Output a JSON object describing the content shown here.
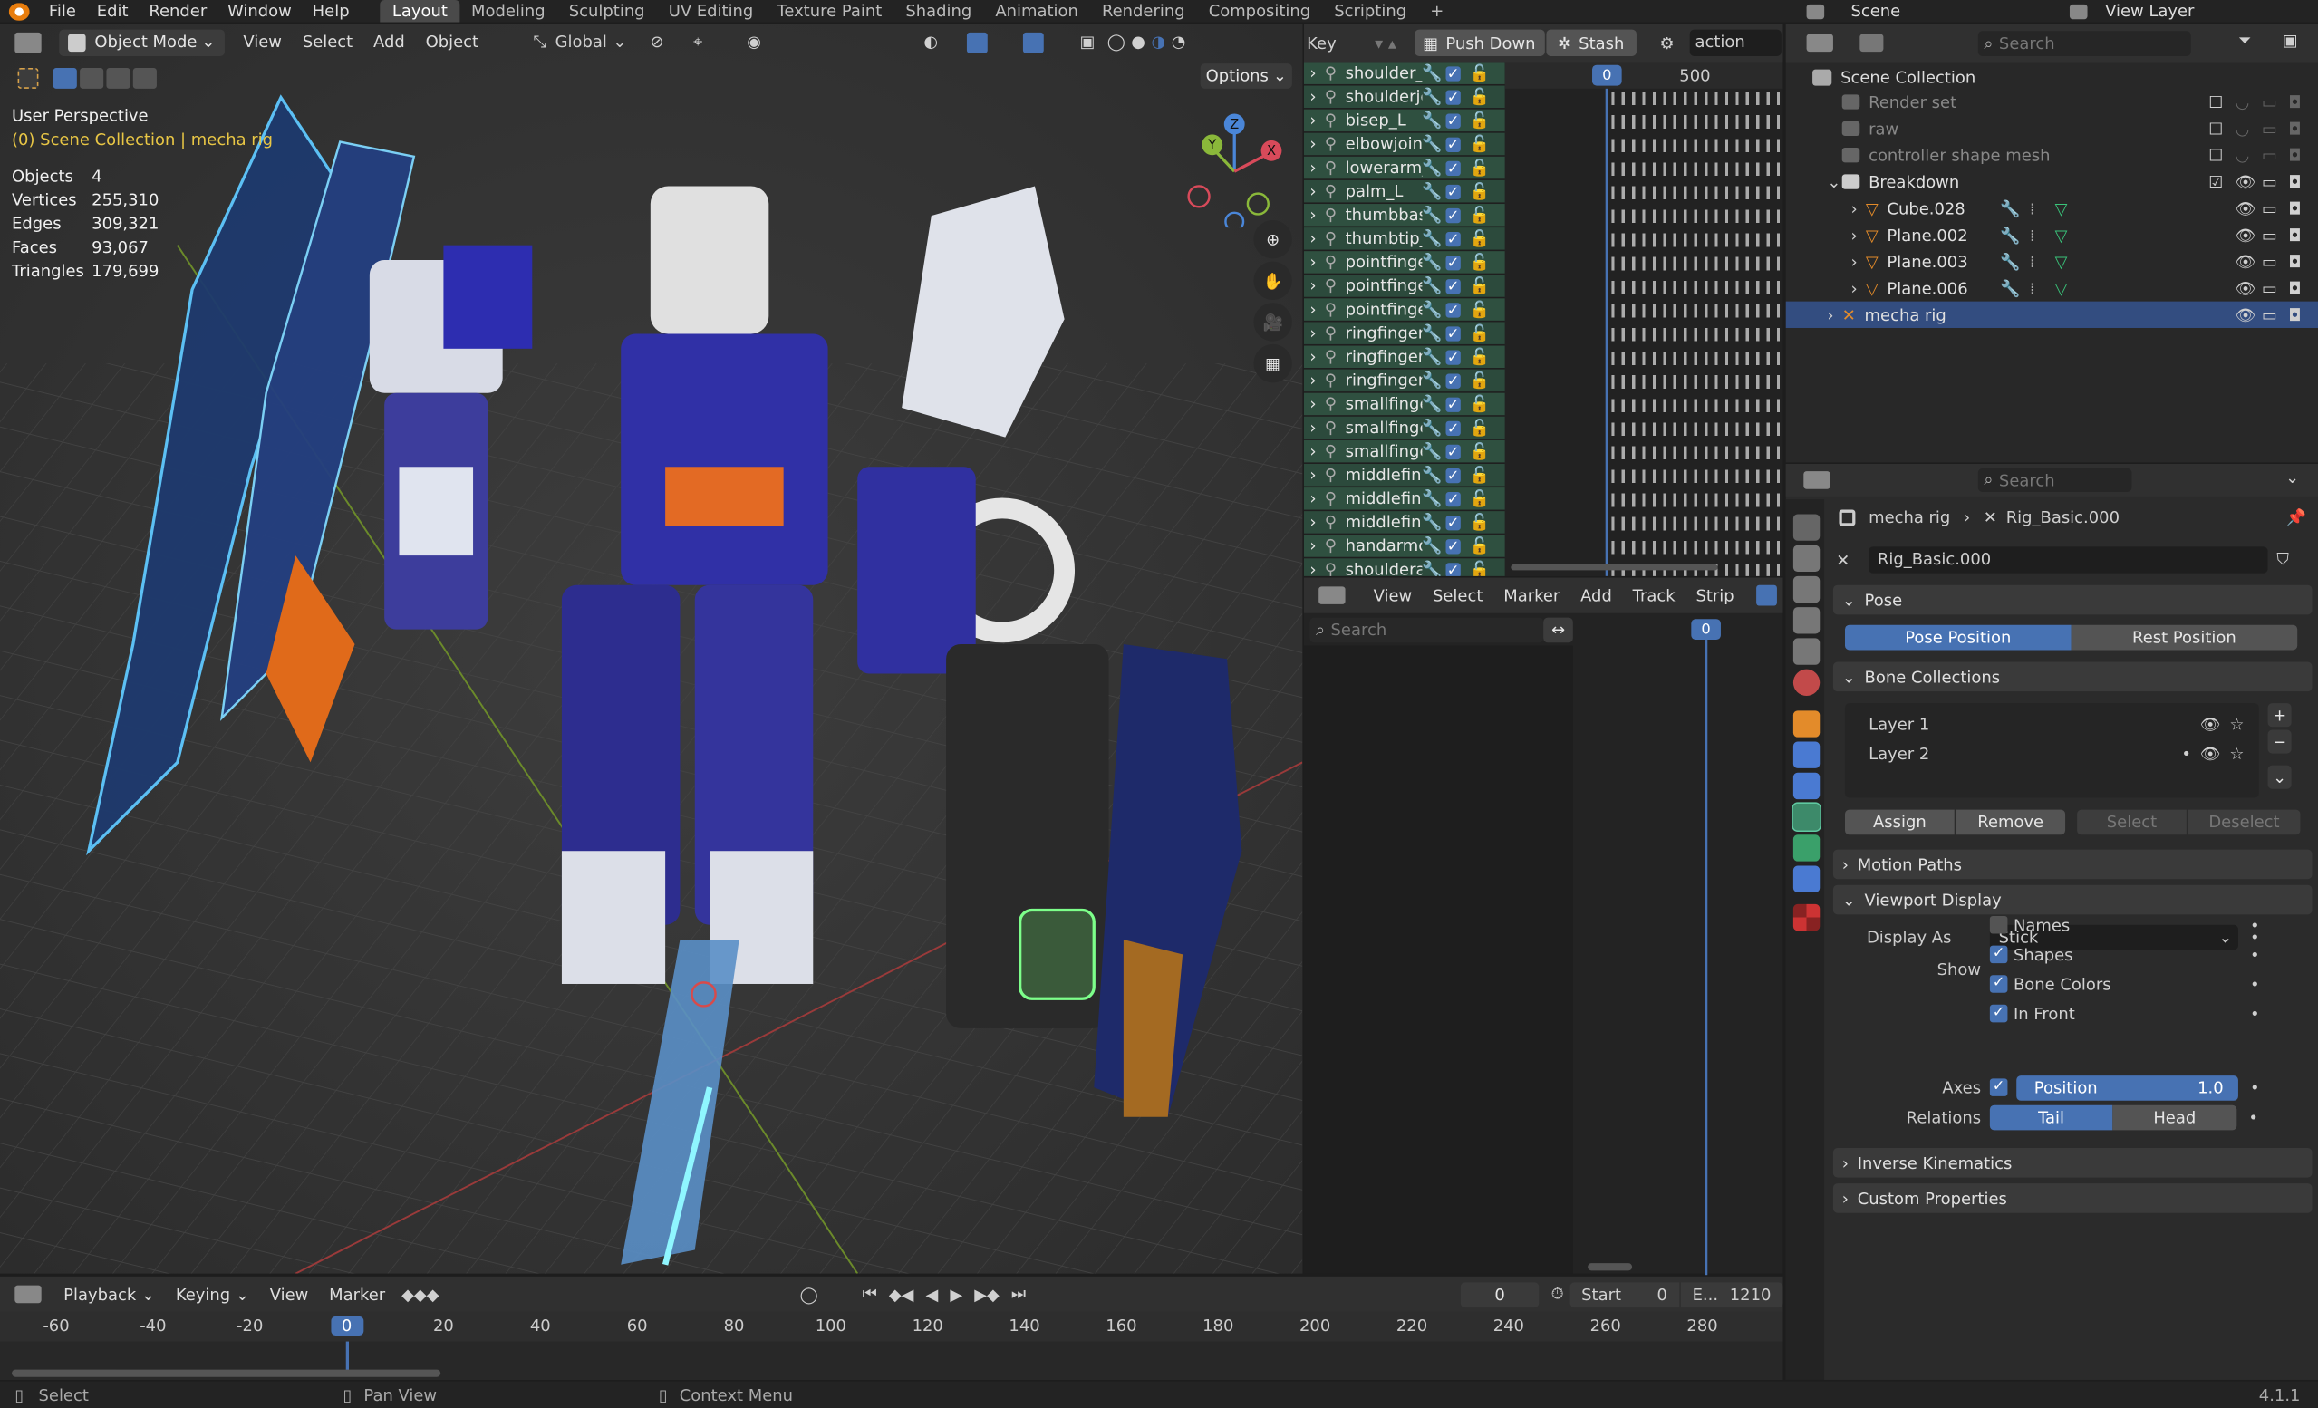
{
  "topbar": {
    "menus": [
      "File",
      "Edit",
      "Render",
      "Window",
      "Help"
    ],
    "workspaces": [
      "Layout",
      "Modeling",
      "Sculpting",
      "UV Editing",
      "Texture Paint",
      "Shading",
      "Animation",
      "Rendering",
      "Compositing",
      "Scripting"
    ],
    "add_tab": "+",
    "scene_label": "Scene",
    "view_layer_label": "View Layer"
  },
  "viewport": {
    "mode": "Object Mode",
    "menus": [
      "View",
      "Select",
      "Add",
      "Object"
    ],
    "orientation": "Global",
    "options": "Options",
    "title": "User Perspective",
    "collection_text": "(0) Scene Collection | mecha rig",
    "stats": [
      {
        "label": "Objects",
        "value": "4"
      },
      {
        "label": "Vertices",
        "value": "255,310"
      },
      {
        "label": "Edges",
        "value": "309,321"
      },
      {
        "label": "Faces",
        "value": "93,067"
      },
      {
        "label": "Triangles",
        "value": "179,699"
      }
    ],
    "gizmo": {
      "z": "Z",
      "y": "Y",
      "x": "X"
    }
  },
  "nla": {
    "key_label": "Key",
    "push_down": "Push Down",
    "stash": "Stash",
    "action_name": "action",
    "frame_current": "0",
    "frame_500": "500",
    "tracks": [
      "shoulder_",
      "shoulderjc",
      "bisep_L",
      "elbowjoint",
      "lowerarm_",
      "palm_L",
      "thumbbas",
      "thumbtip_",
      "pointfinge",
      "pointfinge",
      "pointfinge",
      "ringfinger",
      "ringfinger",
      "ringfinger",
      "smallfinge",
      "smallfinge",
      "smallfinge",
      "middlefinc",
      "middlefinc",
      "middlefinc",
      "handarmo",
      "shouldera"
    ]
  },
  "nla_lower": {
    "menus": [
      "View",
      "Select",
      "Marker",
      "Add",
      "Track",
      "Strip"
    ],
    "search_placeholder": "Search",
    "frame": "0"
  },
  "outliner": {
    "search_placeholder": "Search",
    "root": "Scene Collection",
    "items": [
      {
        "name": "Render set",
        "indent": 1
      },
      {
        "name": "raw",
        "indent": 1
      },
      {
        "name": "controller shape mesh",
        "indent": 1
      },
      {
        "name": "Breakdown",
        "indent": 1
      },
      {
        "name": "Cube.028",
        "indent": 2
      },
      {
        "name": "Plane.002",
        "indent": 2
      },
      {
        "name": "Plane.003",
        "indent": 2
      },
      {
        "name": "Plane.006",
        "indent": 2
      },
      {
        "name": "mecha rig",
        "indent": 1
      }
    ]
  },
  "properties": {
    "search_placeholder": "Search",
    "breadcrumb_obj": "mecha rig",
    "breadcrumb_arm": "Rig_Basic.000",
    "datablock": "Rig_Basic.000",
    "pose": {
      "title": "Pose",
      "pose_position": "Pose Position",
      "rest_position": "Rest Position"
    },
    "bone_collections": {
      "title": "Bone Collections",
      "layers": [
        "Layer 1",
        "Layer 2"
      ],
      "assign": "Assign",
      "remove": "Remove",
      "select": "Select",
      "deselect": "Deselect"
    },
    "motion_paths": "Motion Paths",
    "viewport_display": {
      "title": "Viewport Display",
      "display_as_label": "Display As",
      "display_as_value": "Stick",
      "show_label": "Show",
      "show_items": [
        {
          "label": "Names",
          "checked": false
        },
        {
          "label": "Shapes",
          "checked": true
        },
        {
          "label": "Bone Colors",
          "checked": true
        },
        {
          "label": "In Front",
          "checked": true
        }
      ],
      "axes_label": "Axes",
      "axes_position": "Position",
      "axes_value": "1.0",
      "relations_label": "Relations",
      "tail": "Tail",
      "head": "Head"
    },
    "inverse_kinematics": "Inverse Kinematics",
    "custom_properties": "Custom Properties"
  },
  "timeline": {
    "menus": [
      "Playback",
      "Keying",
      "View",
      "Marker"
    ],
    "current_frame": "0",
    "start_label": "Start",
    "start_value": "0",
    "end_label": "E...",
    "end_value": "1210",
    "ticks": [
      "-60",
      "-40",
      "-20",
      "0",
      "20",
      "40",
      "60",
      "80",
      "100",
      "120",
      "140",
      "160",
      "180",
      "200",
      "220",
      "240",
      "260",
      "280"
    ]
  },
  "statusbar": {
    "select": "Select",
    "pan": "Pan View",
    "context": "Context Menu",
    "version": "4.1.1"
  },
  "colors": {
    "accent": "#4772b3",
    "selected_row": "#334d80",
    "header": "#303030",
    "panel": "#2b2b2b"
  }
}
